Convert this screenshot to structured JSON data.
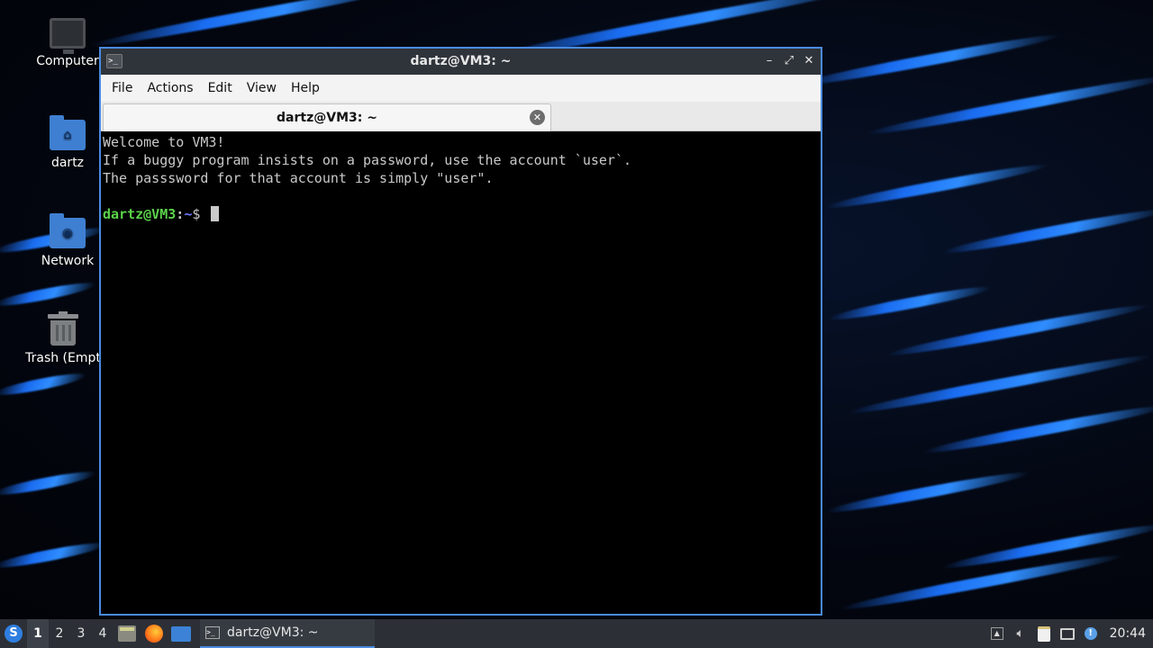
{
  "desktop": {
    "icons": [
      {
        "label": "Computer",
        "icon": "computer-icon"
      },
      {
        "label": "dartz",
        "icon": "home-folder-icon"
      },
      {
        "label": "Network",
        "icon": "network-folder-icon"
      },
      {
        "label": "Trash (Empt",
        "icon": "trash-icon"
      }
    ]
  },
  "window": {
    "title": "dartz@VM3: ~",
    "controls": {
      "minimize": "–",
      "maximize": "⤢",
      "close": "✕"
    },
    "menu": [
      "File",
      "Actions",
      "Edit",
      "View",
      "Help"
    ],
    "tab": {
      "label": "dartz@VM3: ~",
      "close": "✕"
    }
  },
  "terminal": {
    "lines": [
      "Welcome to VM3!",
      "If a buggy program insists on a password, use the account `user`.",
      "The passsword for that account is simply \"user\"."
    ],
    "prompt": {
      "user_host": "dartz@VM3",
      "sep": ":",
      "path": "~",
      "dollar": "$ "
    }
  },
  "taskbar": {
    "workspaces": [
      "1",
      "2",
      "3",
      "4"
    ],
    "active_workspace": "1",
    "launchers": [
      "file-manager-icon",
      "firefox-icon",
      "show-desktop-icon"
    ],
    "task": {
      "label": "dartz@VM3: ~",
      "icon": "terminal-icon"
    },
    "tray": [
      "show-hidden-icon",
      "volume-icon",
      "clipboard-icon",
      "network-icon",
      "notification-icon"
    ],
    "clock": "20:44"
  },
  "colors": {
    "window_border": "#4a8be0",
    "prompt_user": "#5bd14a",
    "prompt_path": "#6b7bff",
    "terminal_bg": "#000000",
    "taskbar_bg": "#2c3036"
  }
}
